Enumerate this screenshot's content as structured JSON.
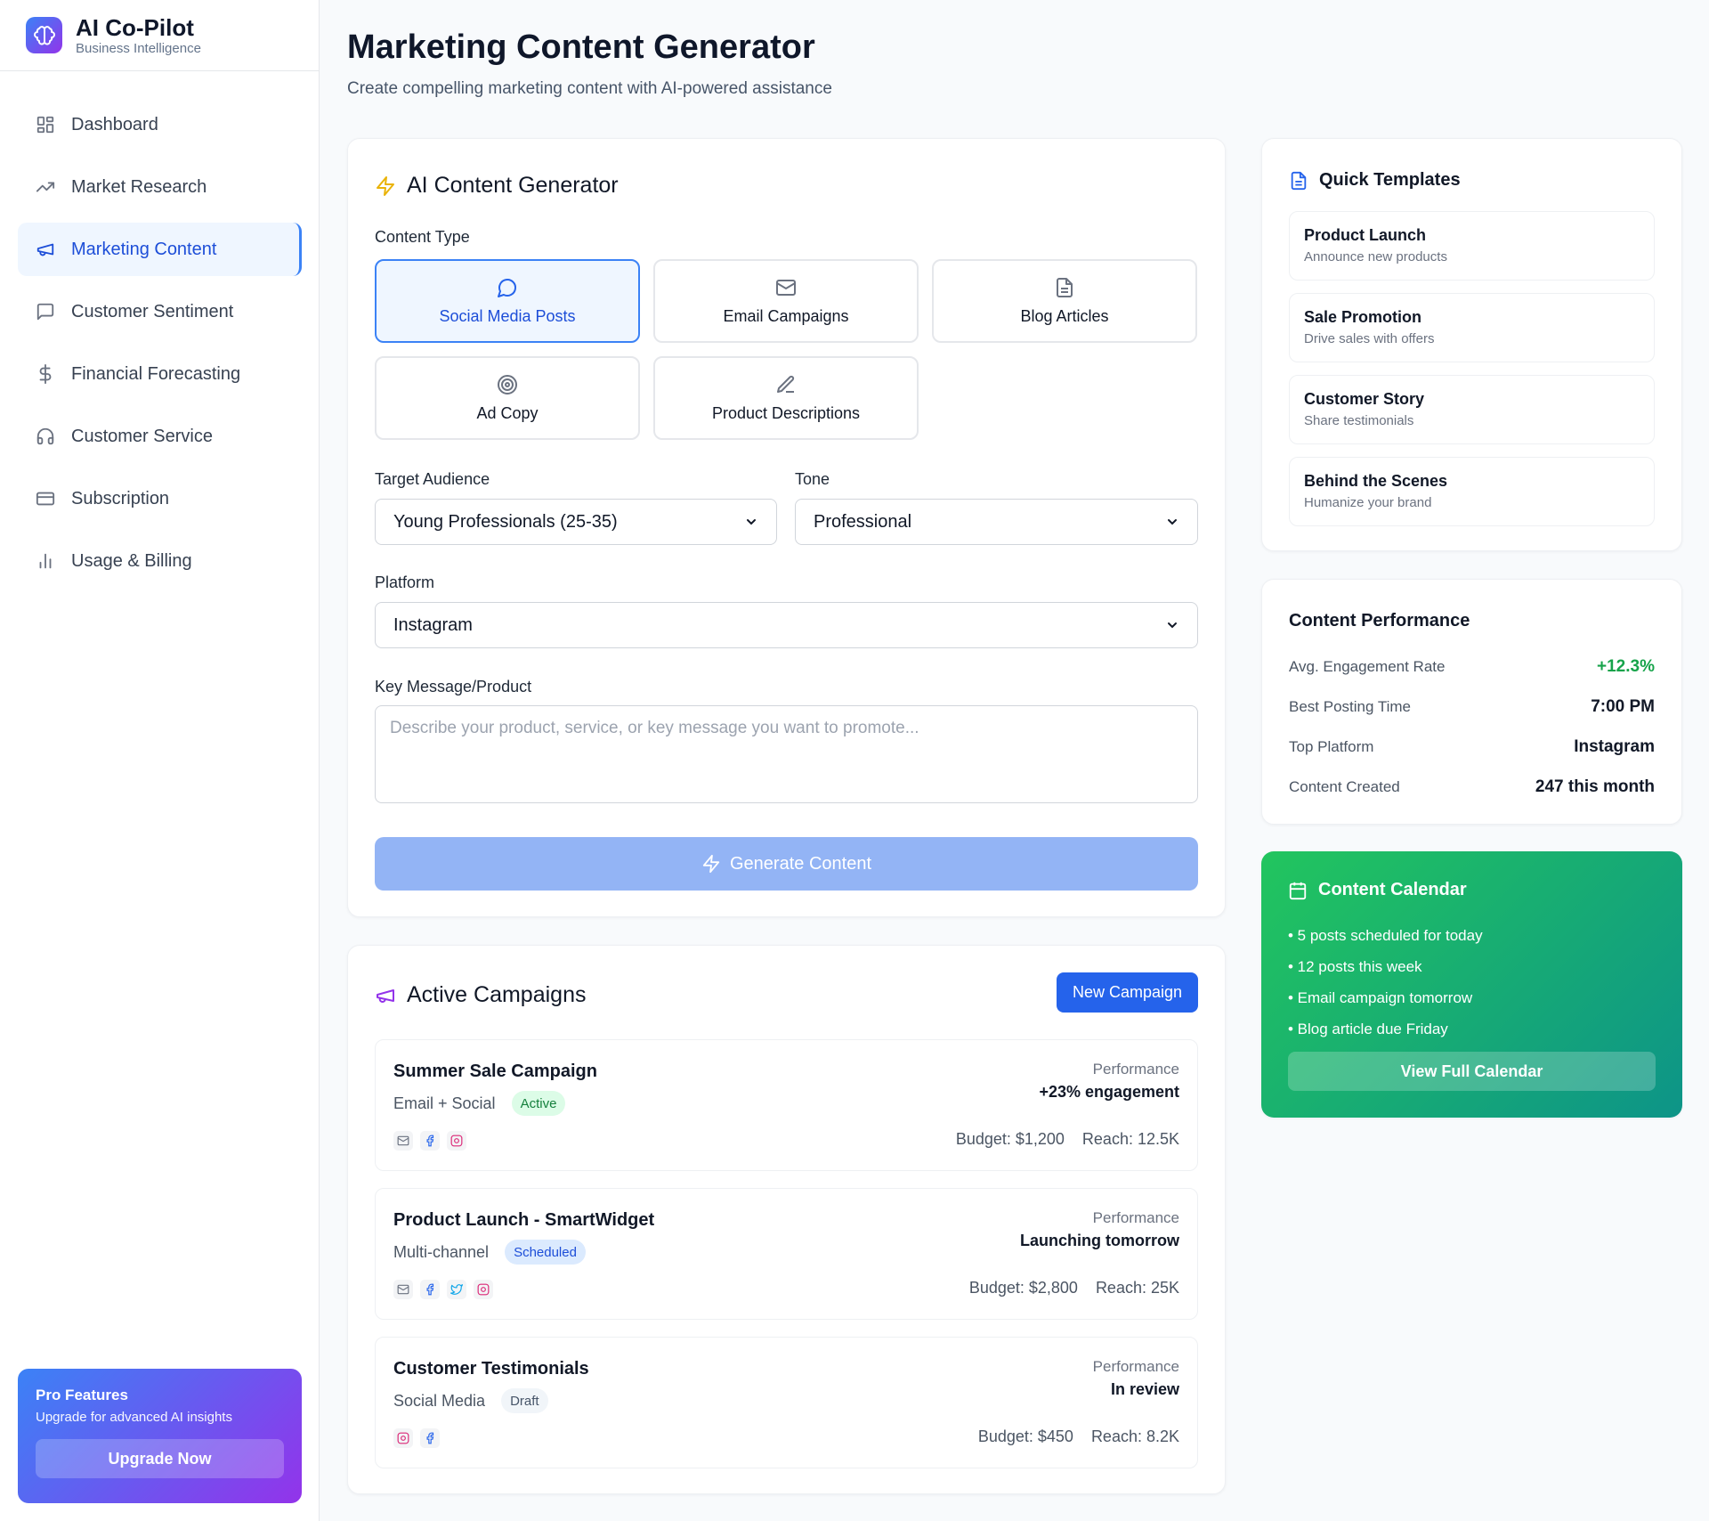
{
  "brand": {
    "title": "AI Co-Pilot",
    "subtitle": "Business Intelligence"
  },
  "nav": [
    {
      "label": "Dashboard",
      "icon": "dashboard-icon"
    },
    {
      "label": "Market Research",
      "icon": "trending-up-icon"
    },
    {
      "label": "Marketing Content",
      "icon": "megaphone-icon",
      "active": true
    },
    {
      "label": "Customer Sentiment",
      "icon": "message-square-icon"
    },
    {
      "label": "Financial Forecasting",
      "icon": "dollar-icon"
    },
    {
      "label": "Customer Service",
      "icon": "headphones-icon"
    },
    {
      "label": "Subscription",
      "icon": "credit-card-icon"
    },
    {
      "label": "Usage & Billing",
      "icon": "bar-chart-icon"
    }
  ],
  "pro": {
    "title": "Pro Features",
    "subtitle": "Upgrade for advanced AI insights",
    "button": "Upgrade Now"
  },
  "page": {
    "title": "Marketing Content Generator",
    "subtitle": "Create compelling marketing content with AI-powered assistance"
  },
  "generator": {
    "title": "AI Content Generator",
    "content_type_label": "Content Type",
    "types": [
      {
        "label": "Social Media Posts",
        "icon": "chat-bubble-icon",
        "selected": true
      },
      {
        "label": "Email Campaigns",
        "icon": "mail-icon"
      },
      {
        "label": "Blog Articles",
        "icon": "document-icon"
      },
      {
        "label": "Ad Copy",
        "icon": "target-icon"
      },
      {
        "label": "Product Descriptions",
        "icon": "pen-icon"
      }
    ],
    "audience_label": "Target Audience",
    "audience_value": "Young Professionals (25-35)",
    "tone_label": "Tone",
    "tone_value": "Professional",
    "platform_label": "Platform",
    "platform_value": "Instagram",
    "message_label": "Key Message/Product",
    "message_placeholder": "Describe your product, service, or key message you want to promote...",
    "generate_button": "Generate Content"
  },
  "campaigns": {
    "title": "Active Campaigns",
    "new_button": "New Campaign",
    "items": [
      {
        "name": "Summer Sale Campaign",
        "channel": "Email + Social",
        "status": "Active",
        "perf_label": "Performance",
        "perf_value": "+23% engagement",
        "budget": "Budget: $1,200",
        "reach": "Reach: 12.5K"
      },
      {
        "name": "Product Launch - SmartWidget",
        "channel": "Multi-channel",
        "status": "Scheduled",
        "perf_label": "Performance",
        "perf_value": "Launching tomorrow",
        "budget": "Budget: $2,800",
        "reach": "Reach: 25K"
      },
      {
        "name": "Customer Testimonials",
        "channel": "Social Media",
        "status": "Draft",
        "perf_label": "Performance",
        "perf_value": "In review",
        "budget": "Budget: $450",
        "reach": "Reach: 8.2K"
      }
    ]
  },
  "templates": {
    "title": "Quick Templates",
    "items": [
      {
        "name": "Product Launch",
        "desc": "Announce new products"
      },
      {
        "name": "Sale Promotion",
        "desc": "Drive sales with offers"
      },
      {
        "name": "Customer Story",
        "desc": "Share testimonials"
      },
      {
        "name": "Behind the Scenes",
        "desc": "Humanize your brand"
      }
    ]
  },
  "performance": {
    "title": "Content Performance",
    "rows": [
      {
        "label": "Avg. Engagement Rate",
        "value": "+12.3%"
      },
      {
        "label": "Best Posting Time",
        "value": "7:00 PM"
      },
      {
        "label": "Top Platform",
        "value": "Instagram"
      },
      {
        "label": "Content Created",
        "value": "247 this month"
      }
    ]
  },
  "calendar": {
    "title": "Content Calendar",
    "items": [
      "• 5 posts scheduled for today",
      "• 12 posts this week",
      "• Email campaign tomorrow",
      "• Blog article due Friday"
    ],
    "button": "View Full Calendar"
  },
  "colors": {
    "accent": "#2563eb",
    "active_bg": "#eff6ff",
    "success": "#16a34a",
    "calendar_from": "#22c55e",
    "calendar_to": "#0d9488"
  }
}
